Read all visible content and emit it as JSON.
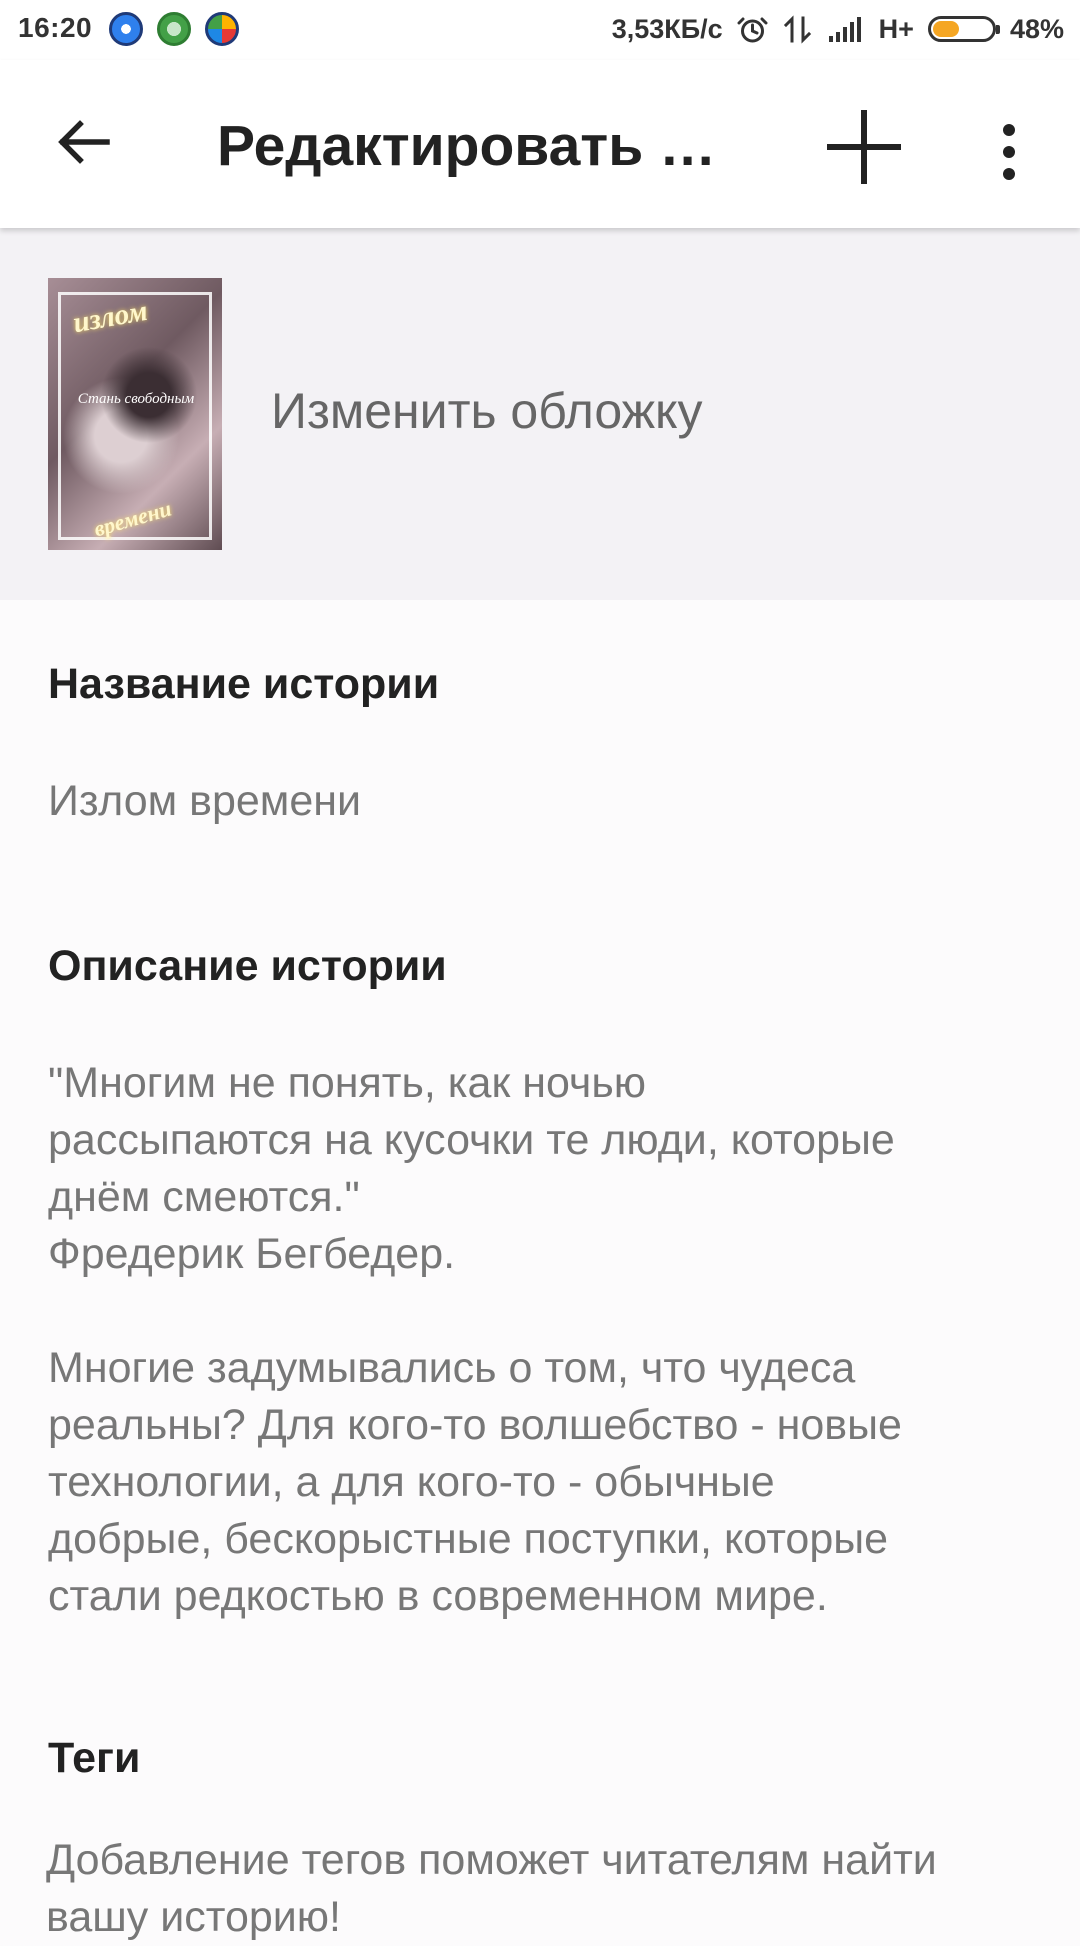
{
  "status_bar": {
    "time": "16:20",
    "network_speed": "3,53КБ/с",
    "network_type": "H+",
    "battery_percent": "48%",
    "battery_level": 0.48,
    "icons": [
      "app-notification-icon",
      "android-icon",
      "play-store-icon",
      "alarm-icon",
      "data-transfer-icon",
      "signal-icon"
    ]
  },
  "app_bar": {
    "title": "Редактировать и...",
    "back_icon": "arrow-left-icon",
    "add_icon": "plus-icon",
    "more_icon": "more-vertical-icon"
  },
  "cover": {
    "action_label": "Изменить обложку",
    "title_top": "излом",
    "tagline": "Стань свободным",
    "title_bottom": "времени"
  },
  "story": {
    "title_heading": "Название истории",
    "title_value": "Излом времени",
    "description_heading": "Описание истории",
    "description_paragraphs": [
      "\"Многим не понять, как ночью\nрассыпаются на кусочки те люди, которые\nднём смеются.\"\nФредерик Бегбедер.",
      "Многие задумывались о том, что чудеса\nреальны? Для кого-то волшебство - новые\nтехнологии, а для кого-то - обычные\nдобрые, бескорыстные поступки, которые\nстали редкостью в современном мире."
    ],
    "tags_heading": "Теги",
    "tags_hint": "Добавление тегов поможет читателям найти вашу историю!"
  },
  "colors": {
    "background": "#fcfbfc",
    "cover_section_background": "#f3f2f5",
    "primary_text": "#222222",
    "secondary_text": "#777777",
    "battery_fill": "#f5a623"
  }
}
